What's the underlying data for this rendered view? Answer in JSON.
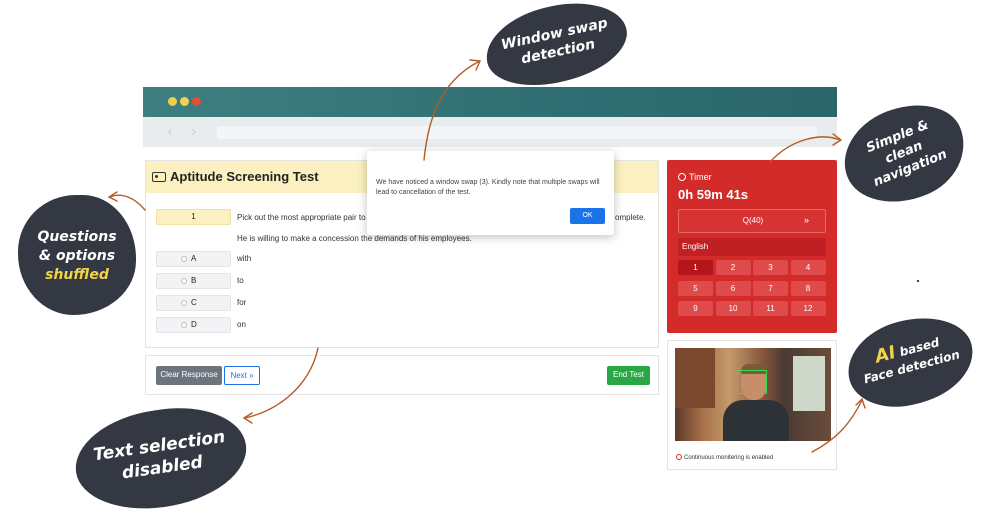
{
  "browser": {
    "back_glyph": "‹",
    "forward_glyph": "›",
    "traffic_light_colors": [
      "#e8d24a",
      "#f1d24e",
      "#e24f3b"
    ]
  },
  "test": {
    "title": "Aptitude Screening Test",
    "question_number": "1",
    "question_text": "Pick out the most appropriate pair to f",
    "question_text_tail": "omplete.",
    "sentence": "He is willing to make a concession the demands of his employees.",
    "options": [
      {
        "letter": "A",
        "text": "with"
      },
      {
        "letter": "B",
        "text": "to"
      },
      {
        "letter": "C",
        "text": "for"
      },
      {
        "letter": "D",
        "text": "on"
      }
    ]
  },
  "actions": {
    "clear_label": "Clear Response",
    "next_label": "Next »",
    "end_label": "End Test"
  },
  "timer": {
    "label": "Timer",
    "value": "0h 59m 41s",
    "question_count": "Q(40)",
    "expand_glyph": "»",
    "language": "English",
    "questions": [
      "1",
      "2",
      "3",
      "4",
      "5",
      "6",
      "7",
      "8",
      "9",
      "10",
      "11",
      "12"
    ],
    "active_question": "1",
    "color": "#d32a2a"
  },
  "camera": {
    "status": "Continuous monitering is enabled"
  },
  "modal": {
    "message": "We have noticed a window swap (3). Kindly note that multiple swaps will lead to cancellation of the test.",
    "ok_label": "OK"
  },
  "callouts": {
    "window_swap": [
      "Window swap",
      "detection"
    ],
    "navigation": [
      "Simple &",
      "clean",
      "navigation"
    ],
    "questions": [
      "Questions",
      "& options",
      "shuffled"
    ],
    "text_selection": [
      "Text selection",
      "disabled"
    ],
    "ai_prefix": "AI",
    "ai_based": "based",
    "ai_face": "Face detection"
  }
}
